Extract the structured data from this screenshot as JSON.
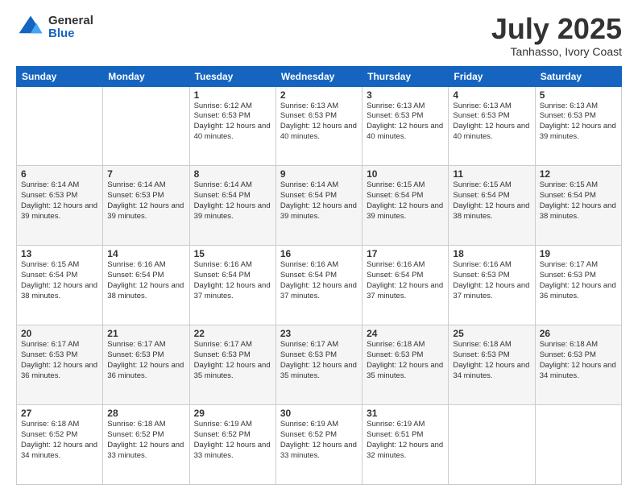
{
  "logo": {
    "general": "General",
    "blue": "Blue"
  },
  "title": "July 2025",
  "location": "Tanhasso, Ivory Coast",
  "weekdays": [
    "Sunday",
    "Monday",
    "Tuesday",
    "Wednesday",
    "Thursday",
    "Friday",
    "Saturday"
  ],
  "weeks": [
    [
      {
        "day": "",
        "sunrise": "",
        "sunset": "",
        "daylight": ""
      },
      {
        "day": "",
        "sunrise": "",
        "sunset": "",
        "daylight": ""
      },
      {
        "day": "1",
        "sunrise": "Sunrise: 6:12 AM",
        "sunset": "Sunset: 6:53 PM",
        "daylight": "Daylight: 12 hours and 40 minutes."
      },
      {
        "day": "2",
        "sunrise": "Sunrise: 6:13 AM",
        "sunset": "Sunset: 6:53 PM",
        "daylight": "Daylight: 12 hours and 40 minutes."
      },
      {
        "day": "3",
        "sunrise": "Sunrise: 6:13 AM",
        "sunset": "Sunset: 6:53 PM",
        "daylight": "Daylight: 12 hours and 40 minutes."
      },
      {
        "day": "4",
        "sunrise": "Sunrise: 6:13 AM",
        "sunset": "Sunset: 6:53 PM",
        "daylight": "Daylight: 12 hours and 40 minutes."
      },
      {
        "day": "5",
        "sunrise": "Sunrise: 6:13 AM",
        "sunset": "Sunset: 6:53 PM",
        "daylight": "Daylight: 12 hours and 39 minutes."
      }
    ],
    [
      {
        "day": "6",
        "sunrise": "Sunrise: 6:14 AM",
        "sunset": "Sunset: 6:53 PM",
        "daylight": "Daylight: 12 hours and 39 minutes."
      },
      {
        "day": "7",
        "sunrise": "Sunrise: 6:14 AM",
        "sunset": "Sunset: 6:53 PM",
        "daylight": "Daylight: 12 hours and 39 minutes."
      },
      {
        "day": "8",
        "sunrise": "Sunrise: 6:14 AM",
        "sunset": "Sunset: 6:54 PM",
        "daylight": "Daylight: 12 hours and 39 minutes."
      },
      {
        "day": "9",
        "sunrise": "Sunrise: 6:14 AM",
        "sunset": "Sunset: 6:54 PM",
        "daylight": "Daylight: 12 hours and 39 minutes."
      },
      {
        "day": "10",
        "sunrise": "Sunrise: 6:15 AM",
        "sunset": "Sunset: 6:54 PM",
        "daylight": "Daylight: 12 hours and 39 minutes."
      },
      {
        "day": "11",
        "sunrise": "Sunrise: 6:15 AM",
        "sunset": "Sunset: 6:54 PM",
        "daylight": "Daylight: 12 hours and 38 minutes."
      },
      {
        "day": "12",
        "sunrise": "Sunrise: 6:15 AM",
        "sunset": "Sunset: 6:54 PM",
        "daylight": "Daylight: 12 hours and 38 minutes."
      }
    ],
    [
      {
        "day": "13",
        "sunrise": "Sunrise: 6:15 AM",
        "sunset": "Sunset: 6:54 PM",
        "daylight": "Daylight: 12 hours and 38 minutes."
      },
      {
        "day": "14",
        "sunrise": "Sunrise: 6:16 AM",
        "sunset": "Sunset: 6:54 PM",
        "daylight": "Daylight: 12 hours and 38 minutes."
      },
      {
        "day": "15",
        "sunrise": "Sunrise: 6:16 AM",
        "sunset": "Sunset: 6:54 PM",
        "daylight": "Daylight: 12 hours and 37 minutes."
      },
      {
        "day": "16",
        "sunrise": "Sunrise: 6:16 AM",
        "sunset": "Sunset: 6:54 PM",
        "daylight": "Daylight: 12 hours and 37 minutes."
      },
      {
        "day": "17",
        "sunrise": "Sunrise: 6:16 AM",
        "sunset": "Sunset: 6:54 PM",
        "daylight": "Daylight: 12 hours and 37 minutes."
      },
      {
        "day": "18",
        "sunrise": "Sunrise: 6:16 AM",
        "sunset": "Sunset: 6:53 PM",
        "daylight": "Daylight: 12 hours and 37 minutes."
      },
      {
        "day": "19",
        "sunrise": "Sunrise: 6:17 AM",
        "sunset": "Sunset: 6:53 PM",
        "daylight": "Daylight: 12 hours and 36 minutes."
      }
    ],
    [
      {
        "day": "20",
        "sunrise": "Sunrise: 6:17 AM",
        "sunset": "Sunset: 6:53 PM",
        "daylight": "Daylight: 12 hours and 36 minutes."
      },
      {
        "day": "21",
        "sunrise": "Sunrise: 6:17 AM",
        "sunset": "Sunset: 6:53 PM",
        "daylight": "Daylight: 12 hours and 36 minutes."
      },
      {
        "day": "22",
        "sunrise": "Sunrise: 6:17 AM",
        "sunset": "Sunset: 6:53 PM",
        "daylight": "Daylight: 12 hours and 35 minutes."
      },
      {
        "day": "23",
        "sunrise": "Sunrise: 6:17 AM",
        "sunset": "Sunset: 6:53 PM",
        "daylight": "Daylight: 12 hours and 35 minutes."
      },
      {
        "day": "24",
        "sunrise": "Sunrise: 6:18 AM",
        "sunset": "Sunset: 6:53 PM",
        "daylight": "Daylight: 12 hours and 35 minutes."
      },
      {
        "day": "25",
        "sunrise": "Sunrise: 6:18 AM",
        "sunset": "Sunset: 6:53 PM",
        "daylight": "Daylight: 12 hours and 34 minutes."
      },
      {
        "day": "26",
        "sunrise": "Sunrise: 6:18 AM",
        "sunset": "Sunset: 6:53 PM",
        "daylight": "Daylight: 12 hours and 34 minutes."
      }
    ],
    [
      {
        "day": "27",
        "sunrise": "Sunrise: 6:18 AM",
        "sunset": "Sunset: 6:52 PM",
        "daylight": "Daylight: 12 hours and 34 minutes."
      },
      {
        "day": "28",
        "sunrise": "Sunrise: 6:18 AM",
        "sunset": "Sunset: 6:52 PM",
        "daylight": "Daylight: 12 hours and 33 minutes."
      },
      {
        "day": "29",
        "sunrise": "Sunrise: 6:19 AM",
        "sunset": "Sunset: 6:52 PM",
        "daylight": "Daylight: 12 hours and 33 minutes."
      },
      {
        "day": "30",
        "sunrise": "Sunrise: 6:19 AM",
        "sunset": "Sunset: 6:52 PM",
        "daylight": "Daylight: 12 hours and 33 minutes."
      },
      {
        "day": "31",
        "sunrise": "Sunrise: 6:19 AM",
        "sunset": "Sunset: 6:51 PM",
        "daylight": "Daylight: 12 hours and 32 minutes."
      },
      {
        "day": "",
        "sunrise": "",
        "sunset": "",
        "daylight": ""
      },
      {
        "day": "",
        "sunrise": "",
        "sunset": "",
        "daylight": ""
      }
    ]
  ]
}
